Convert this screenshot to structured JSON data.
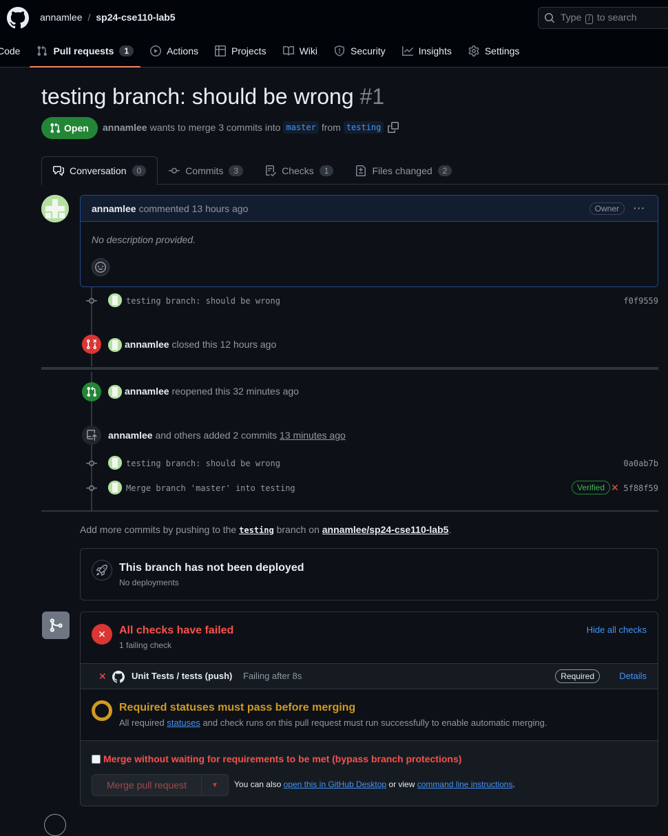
{
  "header": {
    "owner": "annamlee",
    "separator": "/",
    "repo": "sp24-cse110-lab5",
    "search_prefix": "Type",
    "search_key": "/",
    "search_suffix": "to search"
  },
  "nav": {
    "code": "Code",
    "pull_requests": "Pull requests",
    "pull_requests_count": "1",
    "actions": "Actions",
    "projects": "Projects",
    "wiki": "Wiki",
    "security": "Security",
    "insights": "Insights",
    "settings": "Settings"
  },
  "pr": {
    "title": "testing branch: should be wrong",
    "number": "#1",
    "state": "Open",
    "author": "annamlee",
    "meta_text": "wants to merge 3 commits into",
    "base": "master",
    "from_text": "from",
    "head": "testing"
  },
  "tabs": [
    {
      "label": "Conversation",
      "count": "0"
    },
    {
      "label": "Commits",
      "count": "3"
    },
    {
      "label": "Checks",
      "count": "1"
    },
    {
      "label": "Files changed",
      "count": "2"
    }
  ],
  "comment": {
    "author": "annamlee",
    "action": "commented 13 hours ago",
    "badge": "Owner",
    "menu": "···",
    "body": "No description provided."
  },
  "timeline": {
    "commit1_msg": "testing branch: should be wrong",
    "commit1_sha": "f0f9559",
    "closed_user": "annamlee",
    "closed_text": "closed this 12 hours ago",
    "reopened_user": "annamlee",
    "reopened_text": "reopened this 32 minutes ago",
    "added_user": "annamlee",
    "added_text": "and others added 2 commits",
    "added_time": "13 minutes ago",
    "commit2_msg": "testing branch: should be wrong",
    "commit2_sha": "0a0ab7b",
    "commit3_msg": "Merge branch 'master' into testing",
    "commit3_verified": "Verified",
    "commit3_sha": "5f88f59"
  },
  "push_hint": {
    "prefix": "Add more commits by pushing to the",
    "branch": "testing",
    "middle": "branch on",
    "repo": "annamlee/sp24-cse110-lab5",
    "suffix": "."
  },
  "deploy": {
    "title": "This branch has not been deployed",
    "sub": "No deployments"
  },
  "checks": {
    "title": "All checks have failed",
    "sub": "1 failing check",
    "hide": "Hide all checks",
    "unit_name": "Unit Tests / tests (push)",
    "unit_status": "Failing after 8s",
    "required": "Required",
    "details": "Details",
    "req_title": "Required statuses must pass before merging",
    "req_sub_prefix": "All required",
    "req_sub_link": "statuses",
    "req_sub_suffix": "and check runs on this pull request must run successfully to enable automatic merging.",
    "bypass": "Merge without waiting for requirements to be met (bypass branch protections)",
    "merge_button": "Merge pull request",
    "also_prefix": "You can also",
    "also_link1": "open this in GitHub Desktop",
    "also_middle": "or view",
    "also_link2": "command line instructions",
    "also_suffix": "."
  },
  "colors": {
    "accent_open": "#238636",
    "accent_closed": "#da3633",
    "link": "#4493f8",
    "warning": "#d29922",
    "danger_text": "#f85149"
  }
}
